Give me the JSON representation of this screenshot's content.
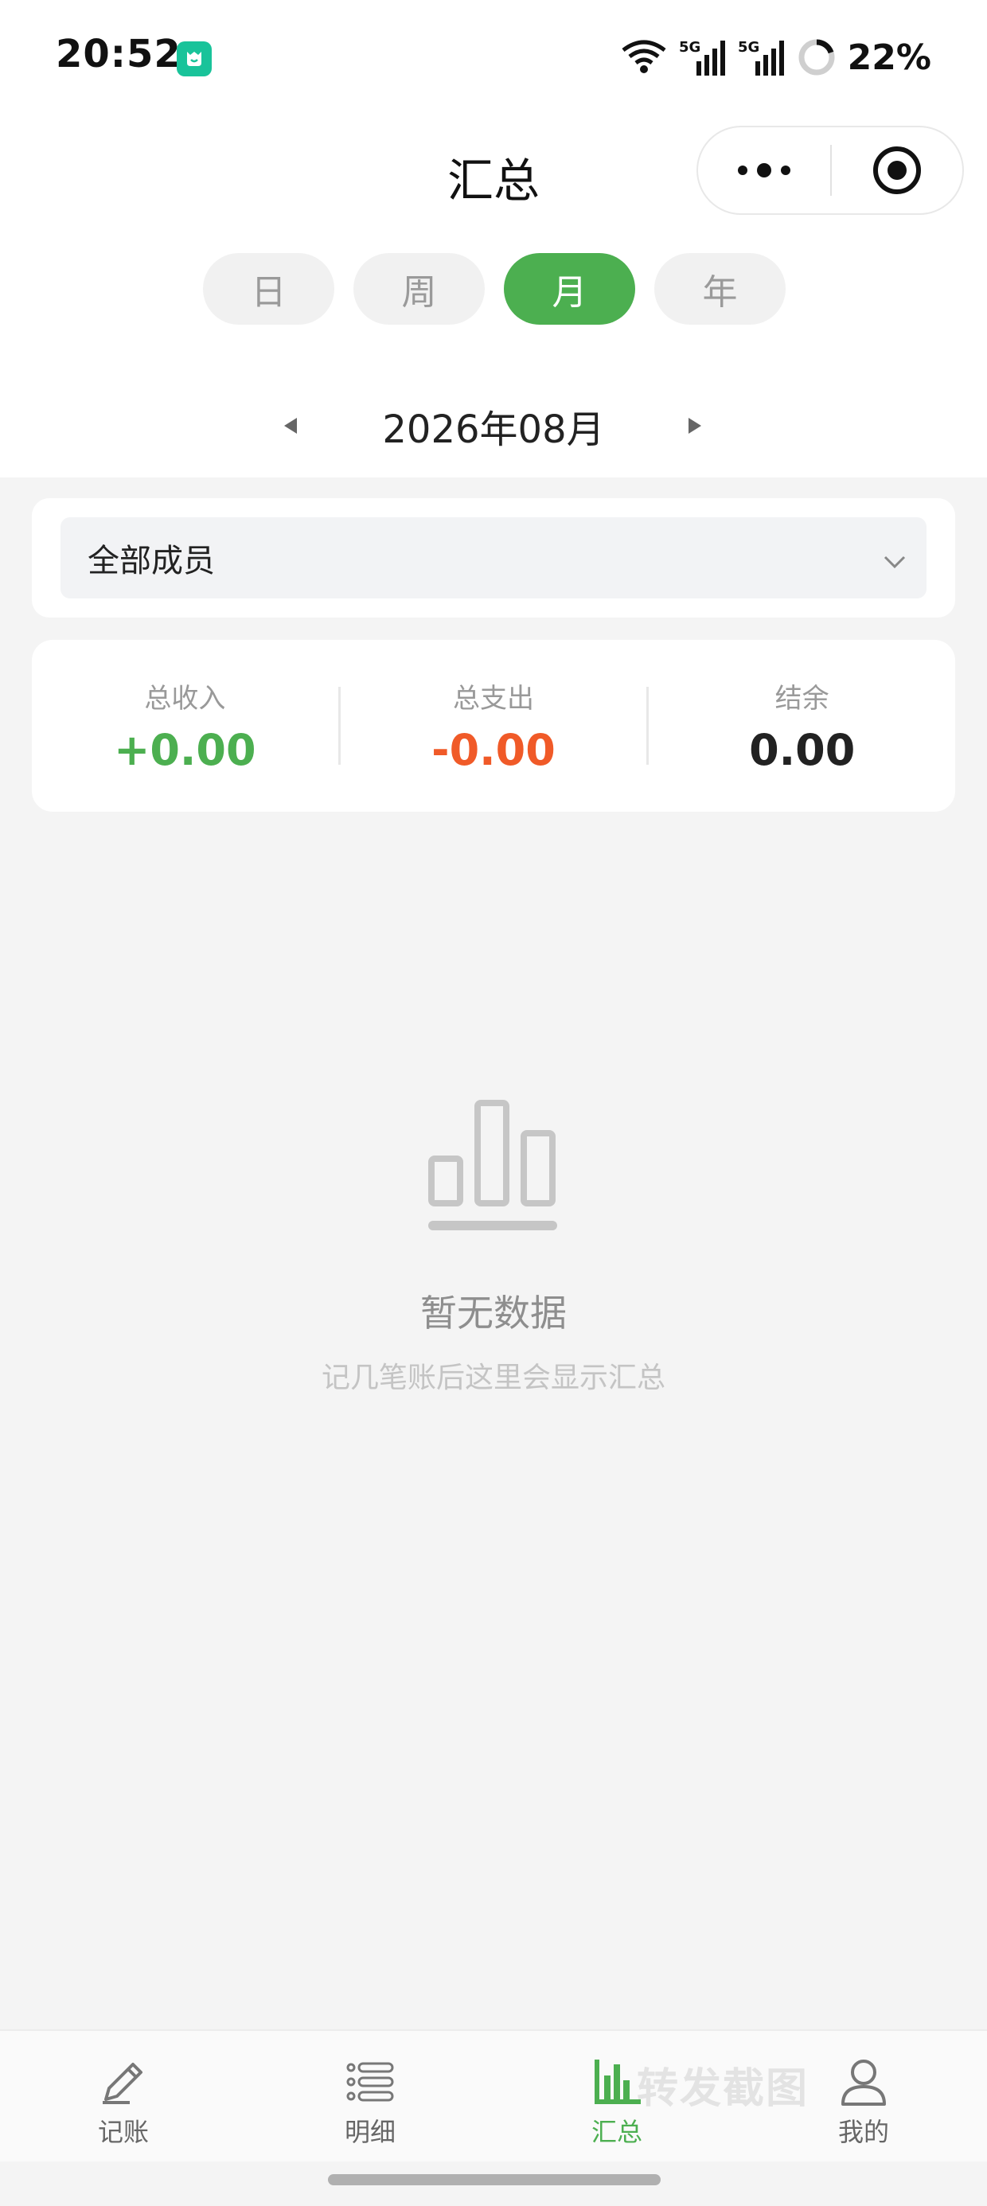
{
  "status_bar": {
    "time": "20:52",
    "battery": "22%",
    "icons": [
      "app-notification-icon",
      "wifi-icon",
      "signal-5g-icon",
      "signal-5g-icon",
      "battery-ring-icon"
    ]
  },
  "header": {
    "title": "汇总",
    "more_icon": "more-dots-icon",
    "close_icon": "target-close-icon"
  },
  "tabs": [
    {
      "label": "日",
      "active": false
    },
    {
      "label": "周",
      "active": false
    },
    {
      "label": "月",
      "active": true
    },
    {
      "label": "年",
      "active": false
    }
  ],
  "date_nav": {
    "label": "2026年08月",
    "prev_icon": "triangle-left-icon",
    "next_icon": "triangle-right-icon"
  },
  "member_filter": {
    "value": "全部成员",
    "icon": "chevron-down-icon"
  },
  "summary": {
    "income_label": "总收入",
    "income_value": "+0.00",
    "expense_label": "总支出",
    "expense_value": "-0.00",
    "balance_label": "结余",
    "balance_value": "0.00"
  },
  "empty_state": {
    "icon": "bar-chart-icon",
    "title": "暂无数据",
    "subtitle": "记几笔账后这里会显示汇总"
  },
  "bottom_nav": [
    {
      "label": "记账",
      "icon": "pencil-icon",
      "active": false
    },
    {
      "label": "明细",
      "icon": "list-icon",
      "active": false
    },
    {
      "label": "汇总",
      "icon": "bar-chart-icon",
      "active": true
    },
    {
      "label": "我的",
      "icon": "user-icon",
      "active": false
    }
  ],
  "watermark": "转发截图",
  "colors": {
    "accent": "#4caf50",
    "expense": "#f05a28",
    "background": "#f4f4f4"
  }
}
